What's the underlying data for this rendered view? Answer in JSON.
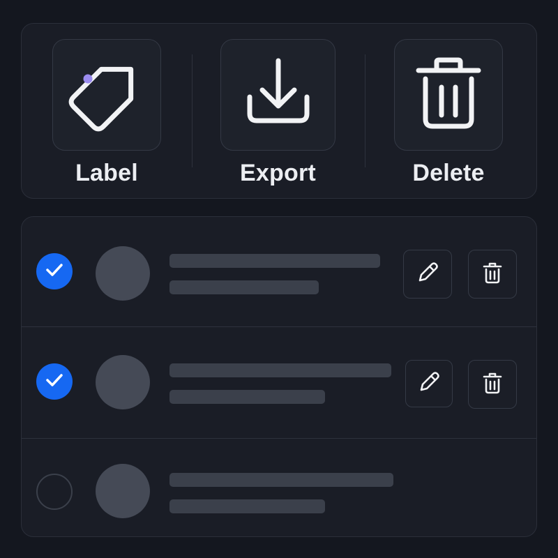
{
  "toolbar": {
    "actions": [
      {
        "label": "Label",
        "icon": "tag-icon"
      },
      {
        "label": "Export",
        "icon": "download-icon"
      },
      {
        "label": "Delete",
        "icon": "trash-icon"
      }
    ]
  },
  "list": {
    "rows": [
      {
        "checked": true
      },
      {
        "checked": true
      },
      {
        "checked": false
      }
    ]
  },
  "colors": {
    "background": "#14171f",
    "panel": "#1a1d26",
    "accent_check": "#1668f2",
    "tag_dot": "#9b8cf0",
    "icon_stroke": "#f2f3f5"
  }
}
